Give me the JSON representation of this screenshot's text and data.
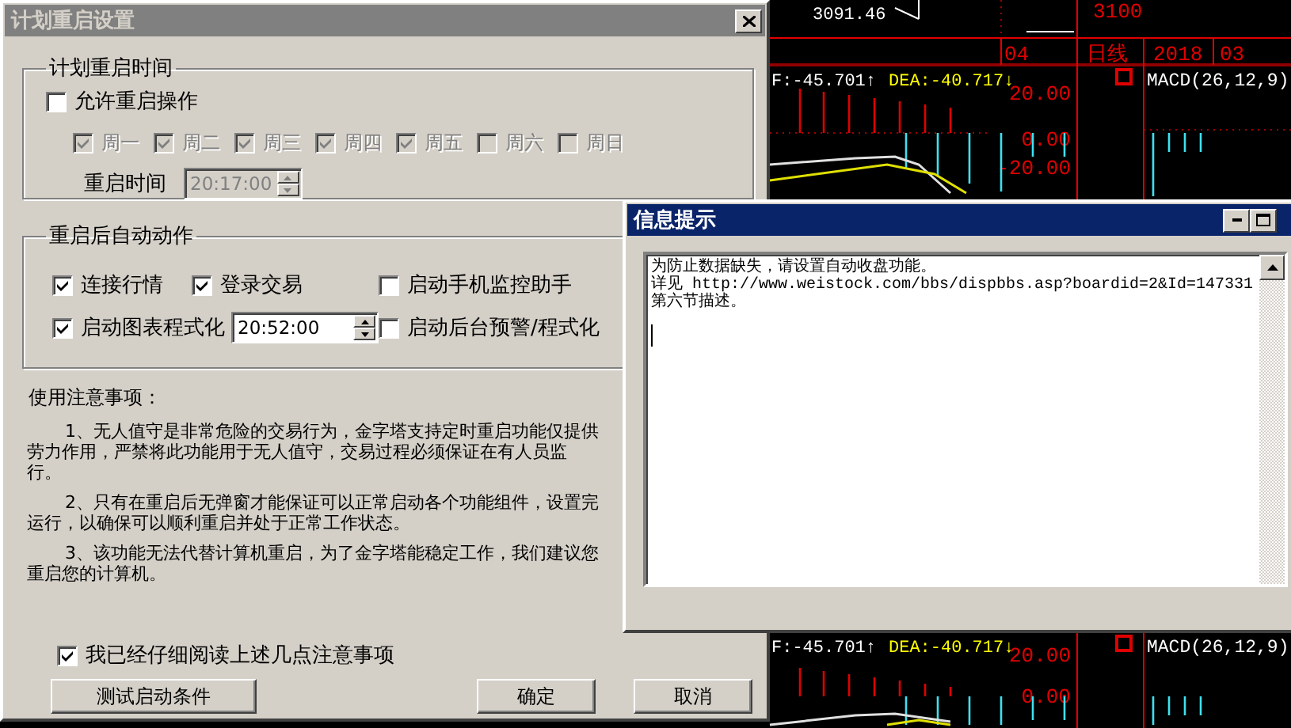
{
  "chart": {
    "price_label": "3091.46",
    "top_axis_value": "3100",
    "date_labels": [
      "04",
      "日线",
      "2018",
      "03"
    ],
    "panels": [
      {
        "dif": "F:-45.701↑",
        "dea": "DEA:-40.717↓",
        "title": "MACD(26,12,9)",
        "axis_values": [
          "20.00",
          "0.00",
          "-20.00"
        ]
      },
      {
        "dif": "F:-45.701↑",
        "dea": "DEA:-40.717↓",
        "title": "MACD(26,12,9)",
        "axis_values": [
          "20.00",
          "0.00"
        ]
      }
    ]
  },
  "restart_dialog": {
    "title": "计划重启设置",
    "schedule_group": {
      "label": "计划重启时间",
      "allow": {
        "label": "允许重启操作",
        "checked": false
      },
      "weekdays": [
        {
          "label": "周一",
          "checked": true,
          "disabled": true
        },
        {
          "label": "周二",
          "checked": true,
          "disabled": true
        },
        {
          "label": "周三",
          "checked": true,
          "disabled": true
        },
        {
          "label": "周四",
          "checked": true,
          "disabled": true
        },
        {
          "label": "周五",
          "checked": true,
          "disabled": true
        },
        {
          "label": "周六",
          "checked": false,
          "disabled": true
        },
        {
          "label": "周日",
          "checked": false,
          "disabled": true
        }
      ],
      "time_label": "重启时间",
      "time_value": "20:17:00",
      "time_disabled": true
    },
    "actions_group": {
      "label": "重启后自动动作",
      "options": [
        {
          "label": "连接行情",
          "checked": true
        },
        {
          "label": "登录交易",
          "checked": true
        },
        {
          "label": "启动手机监控助手",
          "checked": false
        },
        {
          "label": "启动图表程式化",
          "checked": true,
          "time": "20:52:00"
        },
        {
          "label": "启动后台预警/程式化",
          "checked": false
        }
      ]
    },
    "notes": {
      "title": "使用注意事项：",
      "paragraphs": [
        [
          "1、无人值守是非常危险的交易行为，金字塔支持定时重启功能仅提供",
          "劳力作用，严禁将此功能用于无人值守，交易过程必须保证在有人员监",
          "行。"
        ],
        [
          "2、只有在重启后无弹窗才能保证可以正常启动各个功能组件，设置完",
          "运行，以确保可以顺利重启并处于正常工作状态。"
        ],
        [
          "3、该功能无法代替计算机重启，为了金字塔能稳定工作，我们建议您",
          "重启您的计算机。"
        ]
      ]
    },
    "acknowledge": {
      "label": "我已经仔细阅读上述几点注意事项",
      "checked": true
    },
    "buttons": [
      "测试启动条件",
      "确定",
      "取消"
    ]
  },
  "info_dialog": {
    "title": "信息提示",
    "lines": [
      "为防止数据缺失，请设置自动收盘功能。",
      "详见 http://www.weistock.com/bbs/dispbbs.asp?boardid=2&Id=147331",
      "第六节描述。"
    ]
  }
}
